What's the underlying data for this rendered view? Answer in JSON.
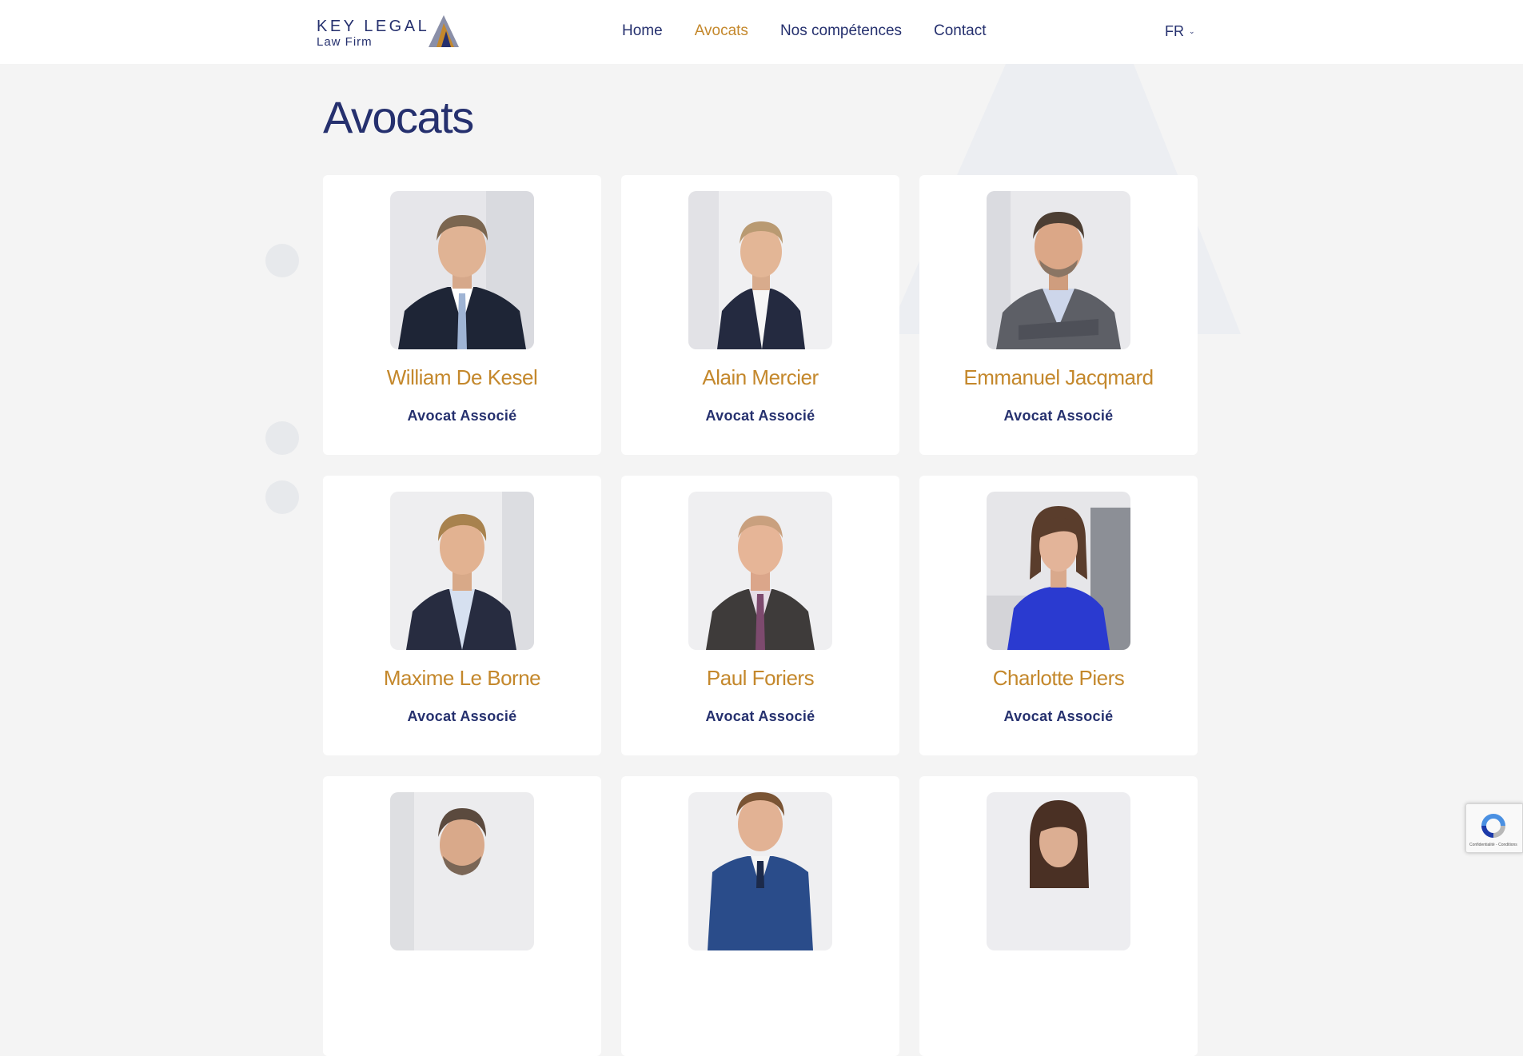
{
  "header": {
    "logo": {
      "line1": "KEY LEGAL",
      "line2": "Law Firm"
    },
    "nav": [
      {
        "label": "Home"
      },
      {
        "label": "Avocats"
      },
      {
        "label": "Nos compétences"
      },
      {
        "label": "Contact"
      }
    ],
    "language": "FR"
  },
  "main": {
    "title": "Avocats",
    "lawyers": [
      {
        "name": "William De Kesel",
        "role": "Avocat Associé"
      },
      {
        "name": "Alain Mercier",
        "role": "Avocat Associé"
      },
      {
        "name": "Emmanuel Jacqmard",
        "role": "Avocat Associé"
      },
      {
        "name": "Maxime Le Borne",
        "role": "Avocat Associé"
      },
      {
        "name": "Paul Foriers",
        "role": "Avocat Associé"
      },
      {
        "name": "Charlotte Piers",
        "role": "Avocat Associé"
      },
      {
        "name": "",
        "role": ""
      },
      {
        "name": "",
        "role": ""
      },
      {
        "name": "",
        "role": ""
      }
    ]
  },
  "recaptcha": {
    "text": "Confidentialité - Conditions"
  },
  "colors": {
    "navy": "#25306e",
    "gold": "#c4882c",
    "background": "#f4f4f4"
  }
}
